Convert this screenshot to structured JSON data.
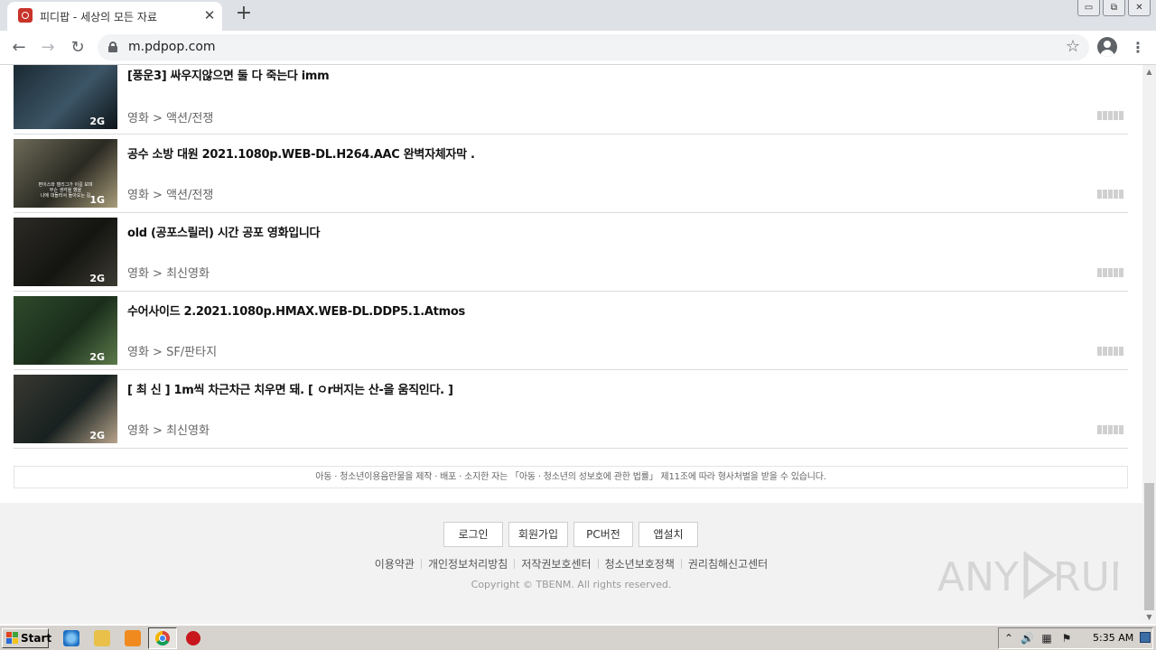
{
  "browser": {
    "tab_title": "피디팝 - 세상의 모든 자료",
    "tab_close": "✕",
    "new_tab": "+",
    "url": "m.pdpop.com",
    "nav_back": "←",
    "nav_forward": "→",
    "nav_reload": "↻",
    "star": "☆",
    "menu": "⋮",
    "window_buttons": [
      "▭",
      "⧉",
      "✕"
    ]
  },
  "items": [
    {
      "title": "[풍운3] 싸우지않으면 둘 다 죽는다 imm",
      "category": "영화 > 액션/전쟁",
      "size": "2G",
      "thumb_colors": [
        "#1b2a33",
        "#3c5566",
        "#0d1418"
      ]
    },
    {
      "title": "공수 소방 대원 2021.1080p.WEB-DL.H264.AAC 완벽자체자막 .",
      "category": "영화 > 액션/전쟁",
      "size": "1G",
      "thumb_colors": [
        "#6d6a58",
        "#2a2a22",
        "#a89c7a"
      ],
      "caption": "편이스와 캘리그가 이길 보며\n무슨 생각을 했을\n나에 대들러서 돌아오는 길"
    },
    {
      "title": "old (공포스릴러) 시간 공포 영화입니다",
      "category": "영화 > 최신영화",
      "size": "2G",
      "thumb_colors": [
        "#2c2b26",
        "#141411",
        "#3d3c33"
      ]
    },
    {
      "title": "수어사이드 2.2021.1080p.HMAX.WEB-DL.DDP5.1.Atmos",
      "category": "영화 > SF/판타지",
      "size": "2G",
      "thumb_colors": [
        "#2f4a2c",
        "#1a2d1b",
        "#5c7a4a"
      ]
    },
    {
      "title": "[ 최 신 ] 1m씩 차근차근 치우면 돼. [ ㅇr버지는 산-을 움직인다. ]",
      "category": "영화 > 최신영화",
      "size": "2G",
      "thumb_colors": [
        "#3a3832",
        "#17211f",
        "#b8a48c"
      ]
    }
  ],
  "notice": "아동 · 청소년이용음란물을 제작 · 배포 · 소지한 자는 「아동 · 청소년의 성보호에 관한 법률」 제11조에 따라 형사처벌을 받을 수 있습니다.",
  "footer": {
    "buttons": [
      "로그인",
      "회원가입",
      "PC버전",
      "앱설치"
    ],
    "links": [
      "이용약관",
      "개인정보처리방침",
      "저작권보호센터",
      "청소년보호정책",
      "권리침해신고센터"
    ],
    "copyright": "Copyright © TBENM. All rights reserved.",
    "watermark": "ANY RUN"
  },
  "taskbar": {
    "start_label": "Start",
    "clock": "5:35 AM",
    "tray_icons": [
      "⌃",
      "🔊",
      "▦",
      "⚑"
    ]
  }
}
